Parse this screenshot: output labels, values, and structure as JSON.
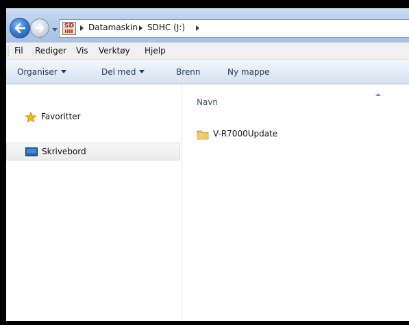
{
  "breadcrumb": {
    "items": [
      "Datamaskin",
      "SDHC (J:)"
    ],
    "location_icon": "sd-card-icon",
    "location_icon_text": "SD"
  },
  "navigation": {
    "back_icon": "back-arrow-icon",
    "forward_icon": "forward-arrow-icon",
    "recent_icon": "chevron-down-icon"
  },
  "menubar": {
    "items": [
      "Fil",
      "Rediger",
      "Vis",
      "Verktøy",
      "Hjelp"
    ]
  },
  "commandbar": {
    "organize": "Organiser",
    "share": "Del med",
    "burn": "Brenn",
    "new_folder": "Ny mappe"
  },
  "navpane": {
    "items": [
      {
        "label": "Favoritter",
        "icon": "star-icon"
      },
      {
        "label": "Skrivebord",
        "icon": "desktop-icon",
        "selected": true
      }
    ]
  },
  "content": {
    "column_header": "Navn",
    "files": [
      {
        "name": "V-R7000Update",
        "icon": "folder-icon"
      }
    ]
  },
  "colors": {
    "star": "#f3b526",
    "folder": "#e9c15a",
    "back_button": "#3b7fd6"
  }
}
